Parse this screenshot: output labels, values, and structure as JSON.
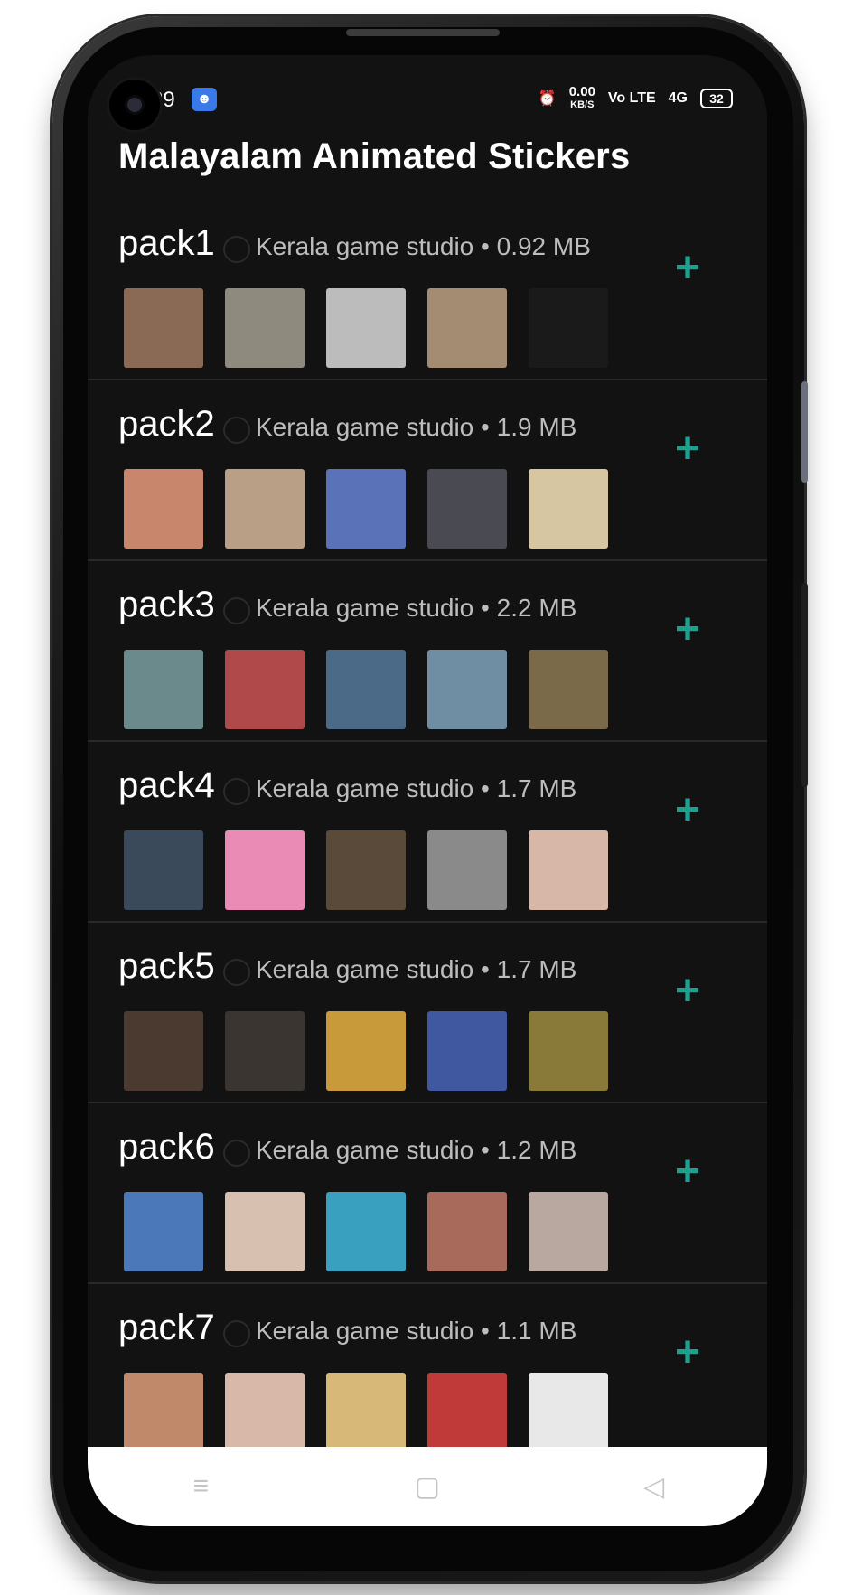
{
  "status_bar": {
    "time": "29",
    "speed_value": "0.00",
    "speed_unit": "KB/S",
    "volte": "Vo LTE",
    "network": "4G",
    "battery": "32"
  },
  "app": {
    "title": "Malayalam Animated Stickers"
  },
  "accent_color": "#1ea08f",
  "packs": [
    {
      "name": "pack1",
      "meta": "Kerala game studio • 0.92 MB",
      "add_label": "+",
      "thumbs": [
        "#8a6a55",
        "#8f8a7e",
        "#bcbcbc",
        "#a48c72",
        "#1a1a1a"
      ]
    },
    {
      "name": "pack2",
      "meta": "Kerala game studio • 1.9 MB",
      "add_label": "+",
      "thumbs": [
        "#c8876d",
        "#b89f86",
        "#5a73b8",
        "#4a4a52",
        "#d7c6a2"
      ]
    },
    {
      "name": "pack3",
      "meta": "Kerala game studio • 2.2 MB",
      "add_label": "+",
      "thumbs": [
        "#6a8a8c",
        "#b04a4a",
        "#4a6a88",
        "#6f8da3",
        "#7b6a4a"
      ]
    },
    {
      "name": "pack4",
      "meta": "Kerala game studio • 1.7 MB",
      "add_label": "+",
      "thumbs": [
        "#3a4a5a",
        "#ea8bb6",
        "#5a4a3a",
        "#8a8a8a",
        "#d7b8a8"
      ]
    },
    {
      "name": "pack5",
      "meta": "Kerala game studio • 1.7 MB",
      "add_label": "+",
      "thumbs": [
        "#4a3a30",
        "#3a3530",
        "#c89a3a",
        "#3f58a0",
        "#8a7a3a"
      ]
    },
    {
      "name": "pack6",
      "meta": "Kerala game studio • 1.2 MB",
      "add_label": "+",
      "thumbs": [
        "#4a78b8",
        "#d8c0b0",
        "#3aa0c0",
        "#a86a5a",
        "#b8a8a0"
      ]
    },
    {
      "name": "pack7",
      "meta": "Kerala game studio • 1.1 MB",
      "add_label": "+",
      "thumbs": [
        "#c08a6a",
        "#d8b8a8",
        "#d8b878",
        "#c03a3a",
        "#e8e8e8"
      ]
    }
  ],
  "nav": {
    "menu_icon": "≡",
    "home_icon": "▢",
    "back_icon": "◁"
  }
}
